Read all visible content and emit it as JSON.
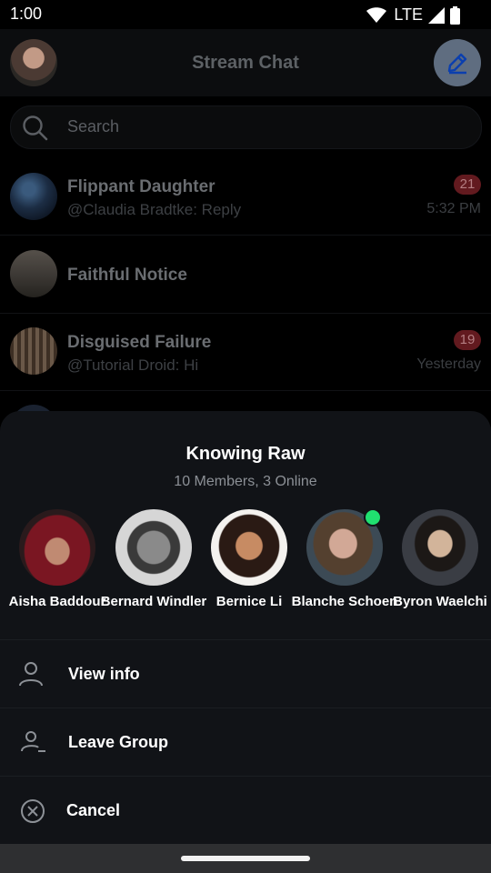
{
  "status_bar": {
    "time": "1:00",
    "network": "LTE"
  },
  "header": {
    "title": "Stream Chat"
  },
  "search": {
    "placeholder": "Search"
  },
  "channels": [
    {
      "name": "Flippant Daughter",
      "preview": "@Claudia Bradtke: Reply",
      "unread": "21",
      "time": "5:32 PM"
    },
    {
      "name": "Faithful Notice",
      "preview": "",
      "unread": "",
      "time": ""
    },
    {
      "name": "Disguised Failure",
      "preview": "@Tutorial Droid: Hi",
      "unread": "19",
      "time": "Yesterday"
    }
  ],
  "sheet": {
    "title": "Knowing Raw",
    "subtitle": "10 Members, 3 Online",
    "members": [
      {
        "name": "Aisha Baddour",
        "online": false
      },
      {
        "name": "Bernard Windler",
        "online": false
      },
      {
        "name": "Bernice Li",
        "online": false
      },
      {
        "name": "Blanche Schoen",
        "online": true
      },
      {
        "name": "Byron Waelchi",
        "online": false
      }
    ],
    "actions": [
      {
        "label": "View info",
        "icon": "person-icon"
      },
      {
        "label": "Leave Group",
        "icon": "person-remove-icon"
      },
      {
        "label": "Cancel",
        "icon": "cancel-circle-icon"
      }
    ]
  },
  "colors": {
    "accent": "#005fff",
    "online": "#20e070",
    "badge": "#ff3742"
  }
}
